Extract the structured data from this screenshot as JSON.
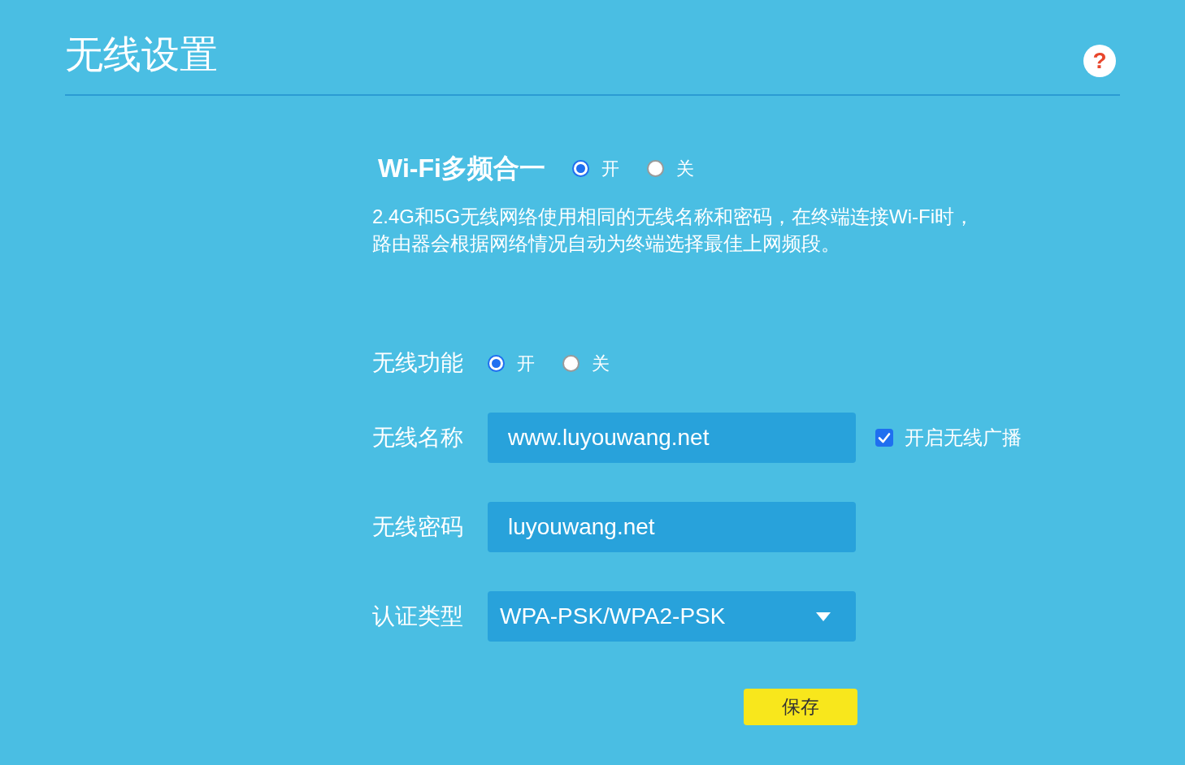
{
  "header": {
    "title": "无线设置",
    "help": "?"
  },
  "multiband": {
    "label": "Wi-Fi多频合一",
    "options": [
      {
        "label": "开",
        "selected": true
      },
      {
        "label": "关",
        "selected": false
      }
    ],
    "description": [
      "2.4G和5G无线网络使用相同的无线名称和密码，在终端连接Wi-Fi时，",
      "路由器会根据网络情况自动为终端选择最佳上网频段。"
    ]
  },
  "fields": [
    {
      "kind": "radio",
      "label": "无线功能",
      "options": [
        {
          "label": "开",
          "selected": true
        },
        {
          "label": "关",
          "selected": false
        }
      ]
    },
    {
      "kind": "text",
      "label": "无线名称",
      "value": "www.luyouwang.net",
      "checkbox": {
        "label": "开启无线广播",
        "checked": true
      }
    },
    {
      "kind": "text",
      "label": "无线密码",
      "value": "luyouwang.net"
    },
    {
      "kind": "select",
      "label": "认证类型",
      "value": "WPA-PSK/WPA2-PSK"
    }
  ],
  "save_button": {
    "label": "保存"
  }
}
